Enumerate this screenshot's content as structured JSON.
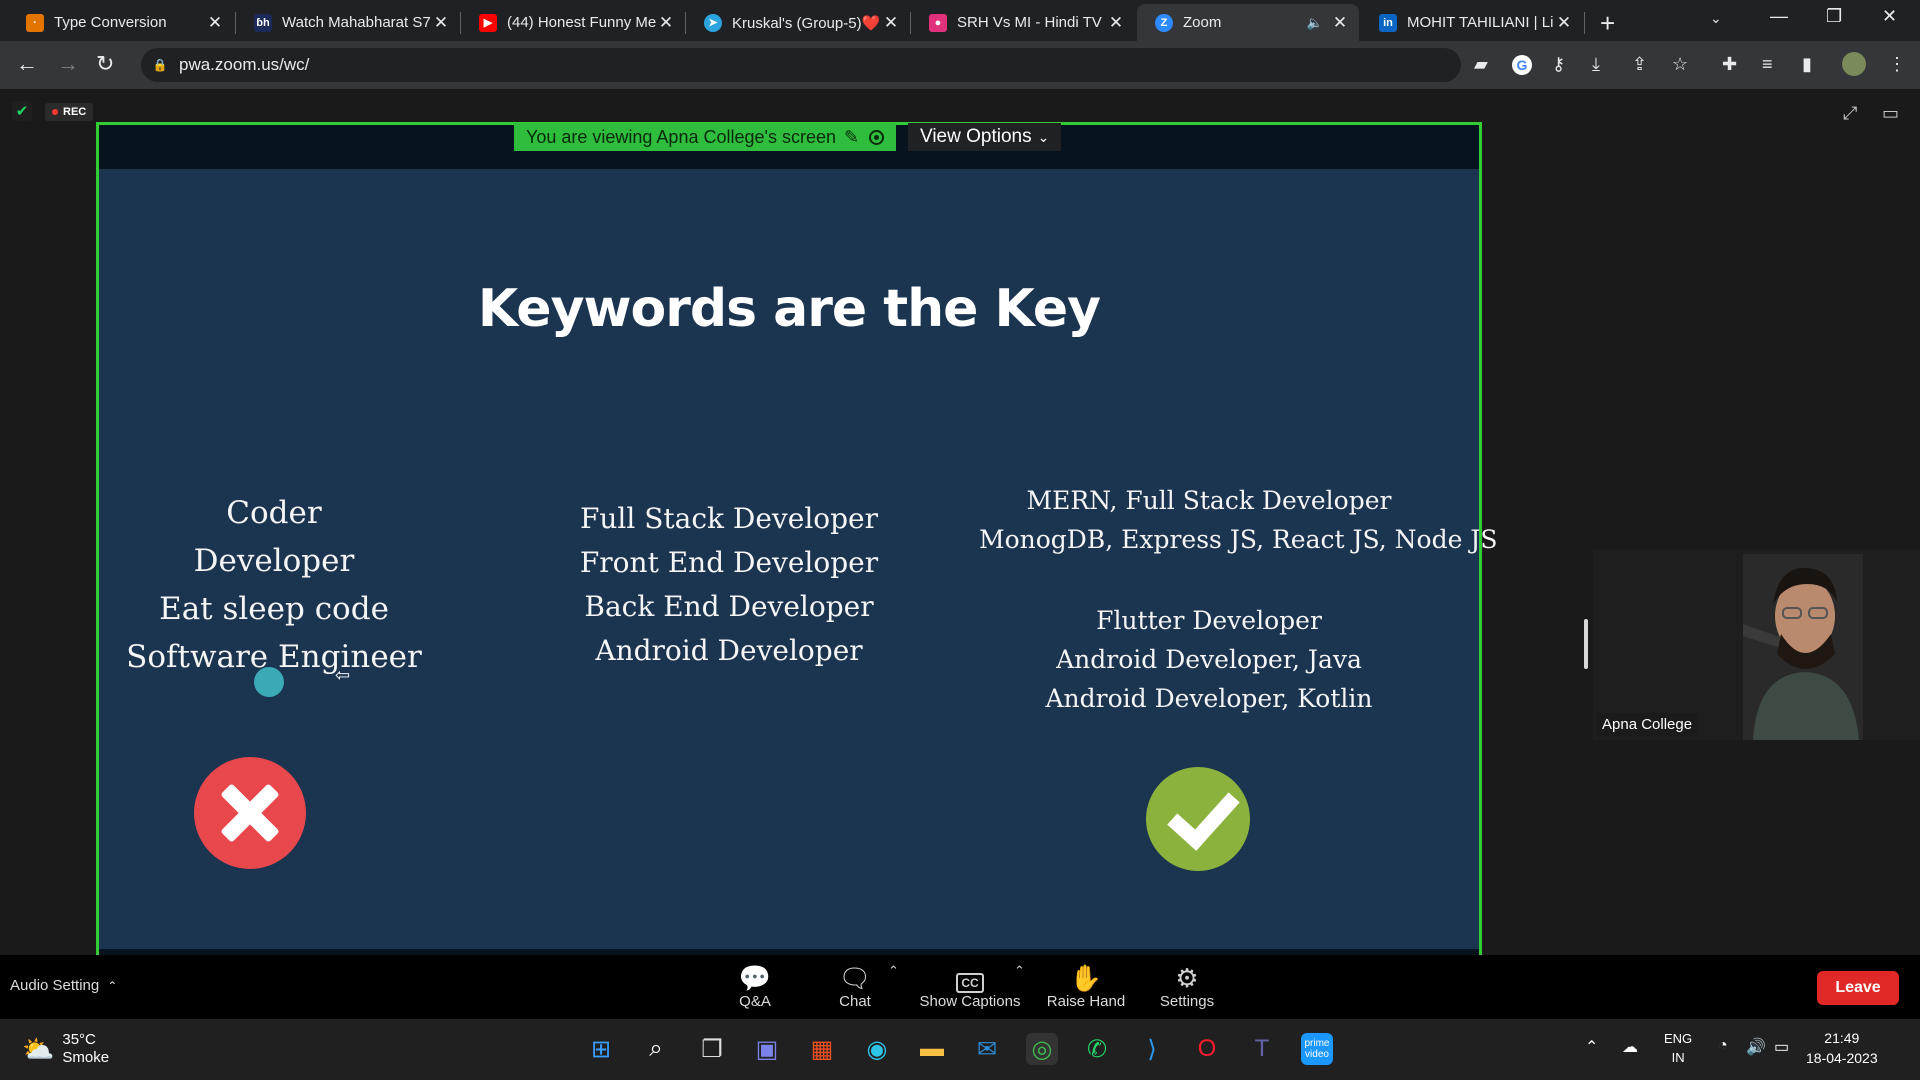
{
  "browser": {
    "tabs": [
      {
        "title": "Type Conversion",
        "favicon": "college-icon",
        "color": "#e37400"
      },
      {
        "title": "Watch Mahabharat S7",
        "favicon": "bh-icon",
        "color": "#1c2a5a"
      },
      {
        "title": "(44) Honest Funny Me",
        "favicon": "youtube-icon",
        "color": "#ff0000"
      },
      {
        "title": "Kruskal's (Group-5)❤️",
        "favicon": "telegram-icon",
        "color": "#2aa3de"
      },
      {
        "title": "SRH Vs MI - Hindi TV",
        "favicon": "live-icon",
        "color": "#e0317a"
      },
      {
        "title": "Zoom",
        "favicon": "zoom-icon",
        "color": "#2d8cff"
      },
      {
        "title": "MOHIT TAHILIANI | Li",
        "favicon": "linkedin-icon",
        "color": "#0a66c2"
      }
    ],
    "url": "pwa.zoom.us/wc/"
  },
  "zoom": {
    "rec_label": "REC",
    "viewing_banner": "You are viewing Apna College's screen",
    "view_options": "View Options",
    "participant_name": "Apna College",
    "controls": {
      "audio_setting": "Audio Setting",
      "qa": "Q&A",
      "chat": "Chat",
      "captions": "Show Captions",
      "raise_hand": "Raise Hand",
      "settings": "Settings",
      "leave": "Leave"
    }
  },
  "slide": {
    "title": "Keywords are the Key",
    "bad_keywords": [
      "Coder",
      "Developer",
      "Eat sleep code",
      "Software Engineer"
    ],
    "generic_roles": [
      "Full Stack Developer",
      "Front End Developer",
      "Back End Developer",
      "Android Developer"
    ],
    "good_group_1": [
      "MERN, Full Stack Developer",
      "MonogDB, Express JS, React JS, Node JS"
    ],
    "good_group_2": [
      "Flutter Developer",
      "Android Developer, Java",
      "Android Developer, Kotlin"
    ]
  },
  "taskbar": {
    "temperature": "35°C",
    "weather": "Smoke",
    "language": "ENG",
    "region": "IN",
    "time": "21:49",
    "date": "18-04-2023"
  }
}
